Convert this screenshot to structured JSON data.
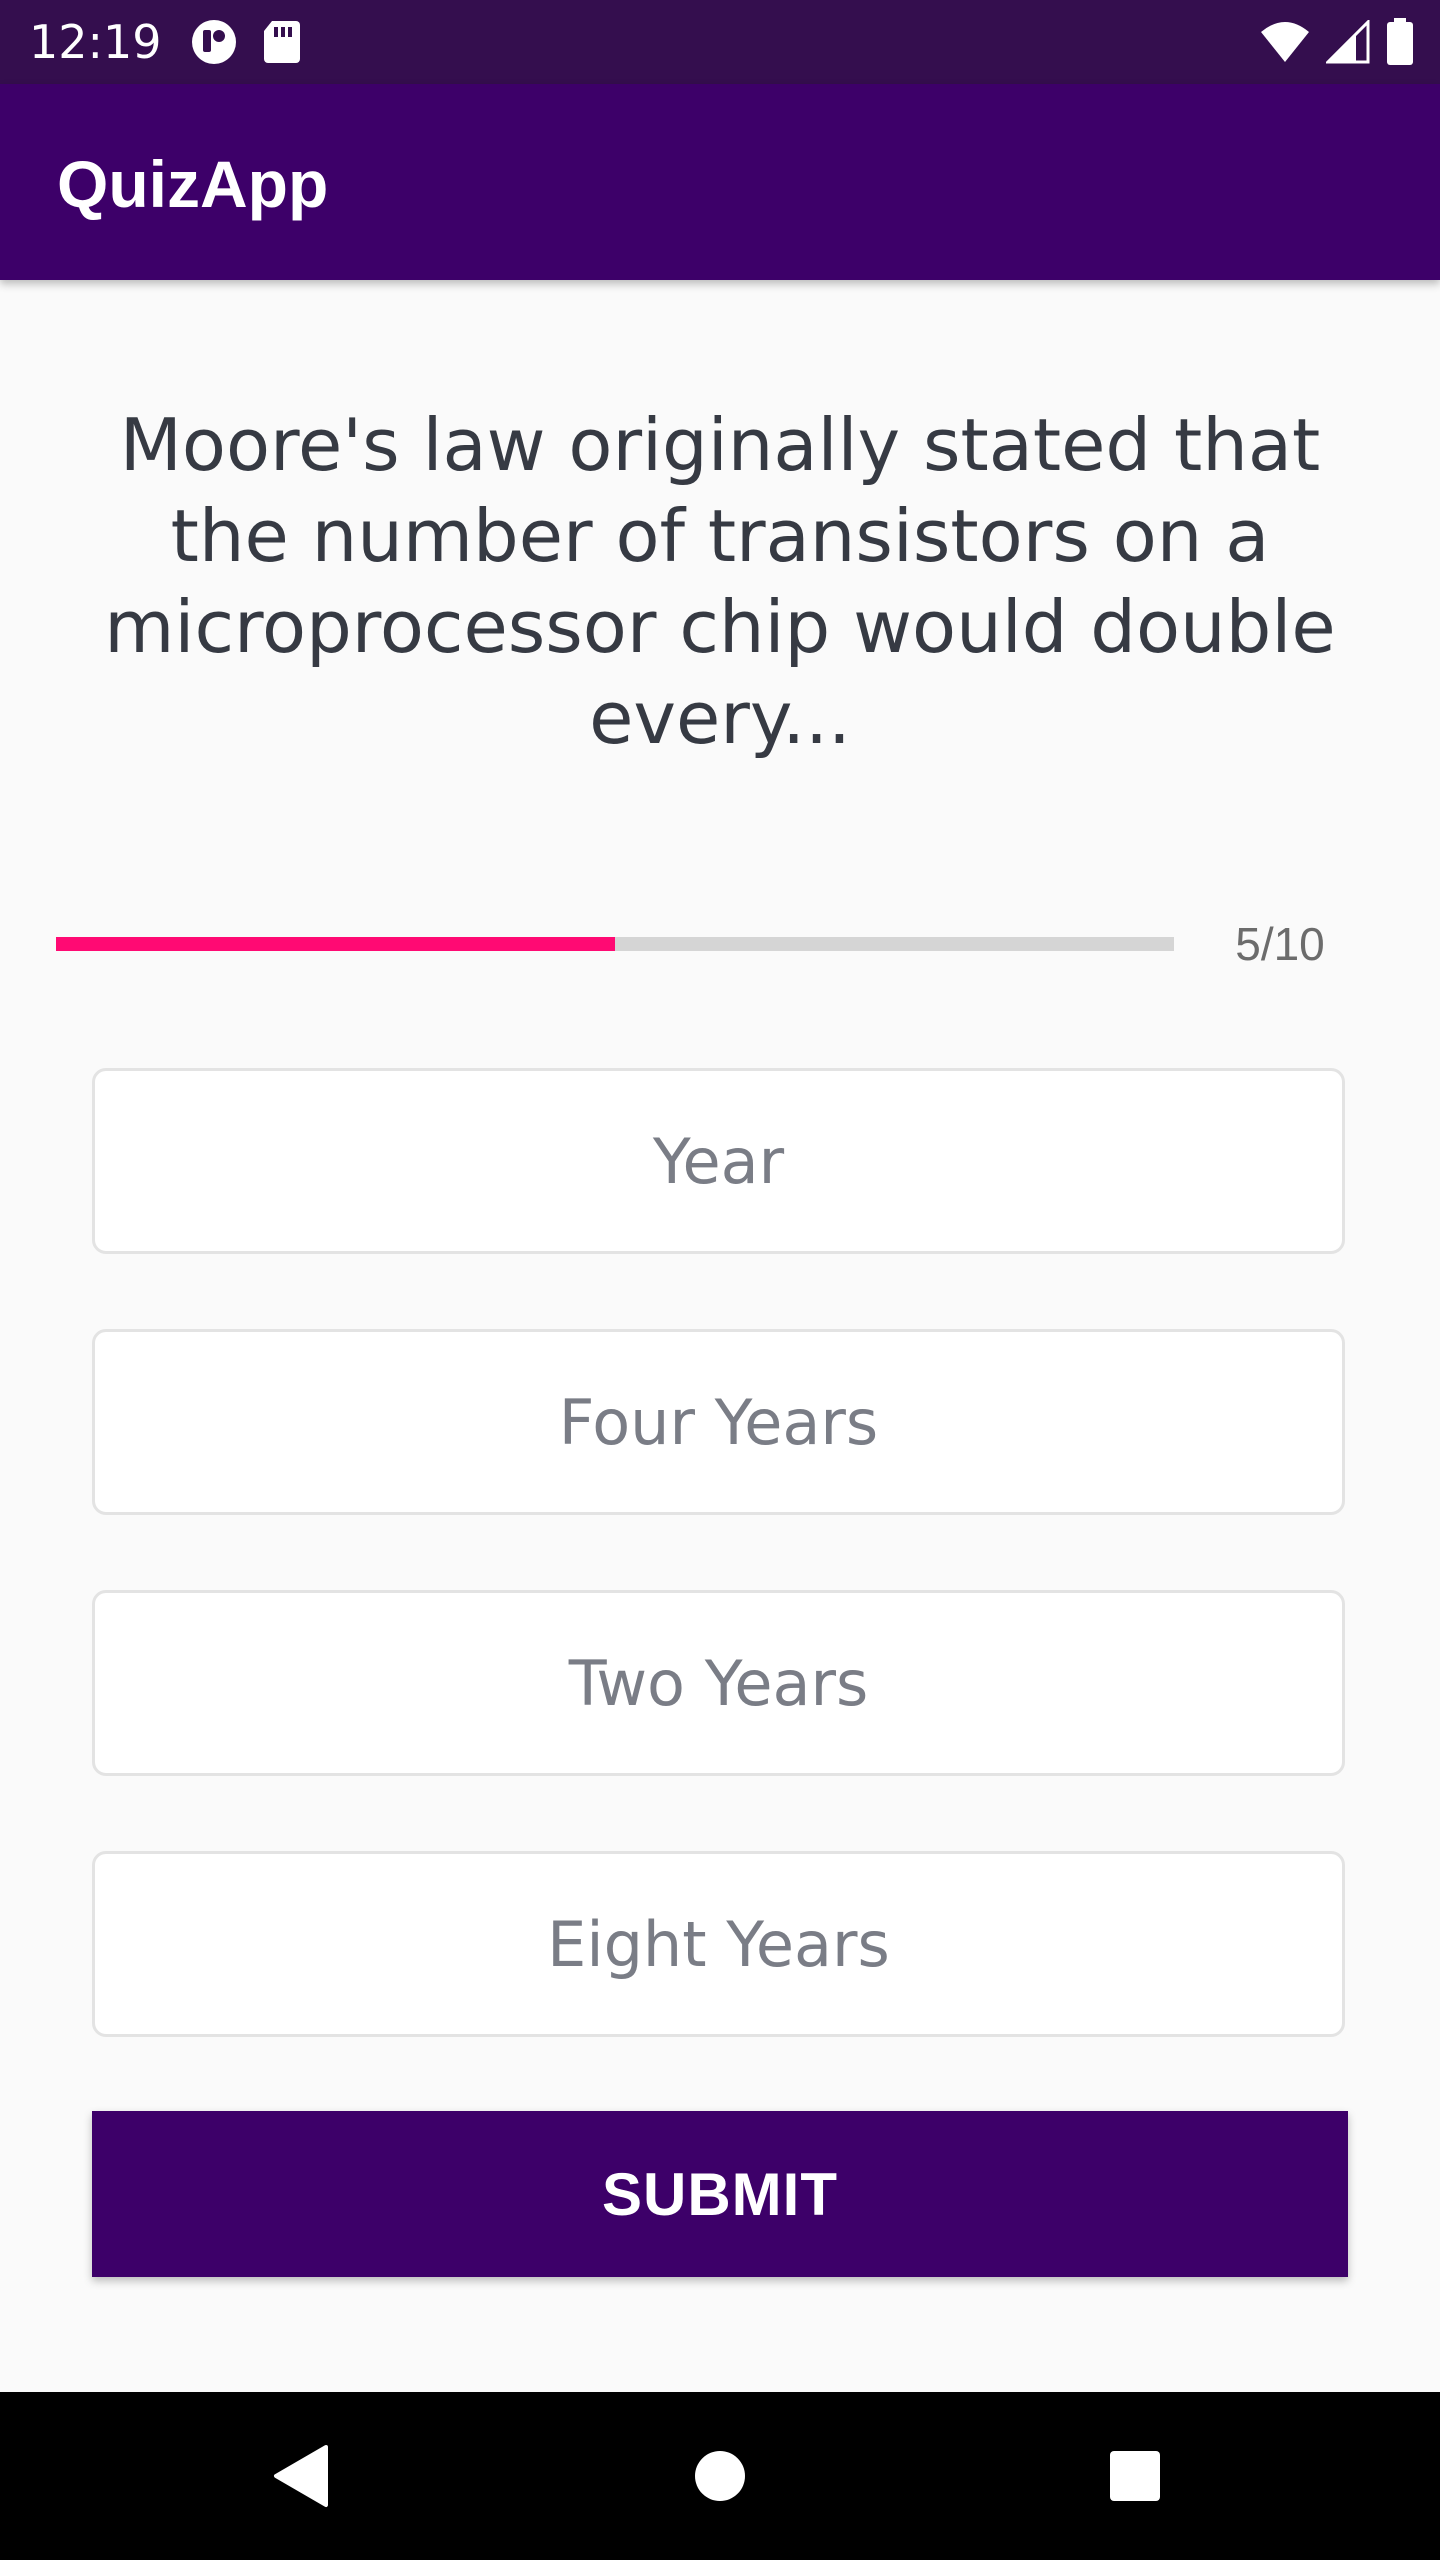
{
  "status_bar": {
    "time": "12:19",
    "left_icons": [
      "notification-app-icon",
      "sd-card-icon"
    ],
    "right_icons": [
      "wifi-icon",
      "cell-signal-icon",
      "battery-icon"
    ]
  },
  "app_bar": {
    "title": "QuizApp"
  },
  "question": {
    "text": "Moore's law originally stated that the number of transistors on a microprocessor chip would double every..."
  },
  "progress": {
    "current": 5,
    "total": 10,
    "label": "5/10",
    "fraction": 0.5,
    "fill_color": "#ff0a73",
    "track_color": "#d5d5d5"
  },
  "options": [
    {
      "label": "Year"
    },
    {
      "label": "Four Years"
    },
    {
      "label": "Two Years"
    },
    {
      "label": "Eight Years"
    }
  ],
  "submit": {
    "label": "SUBMIT"
  },
  "nav_bar": {
    "buttons": [
      "back-icon",
      "home-icon",
      "recents-icon"
    ]
  },
  "colors": {
    "primary": "#3d0069",
    "status_bar": "#340e4e",
    "accent": "#ff0a73",
    "background": "#fafafa"
  }
}
